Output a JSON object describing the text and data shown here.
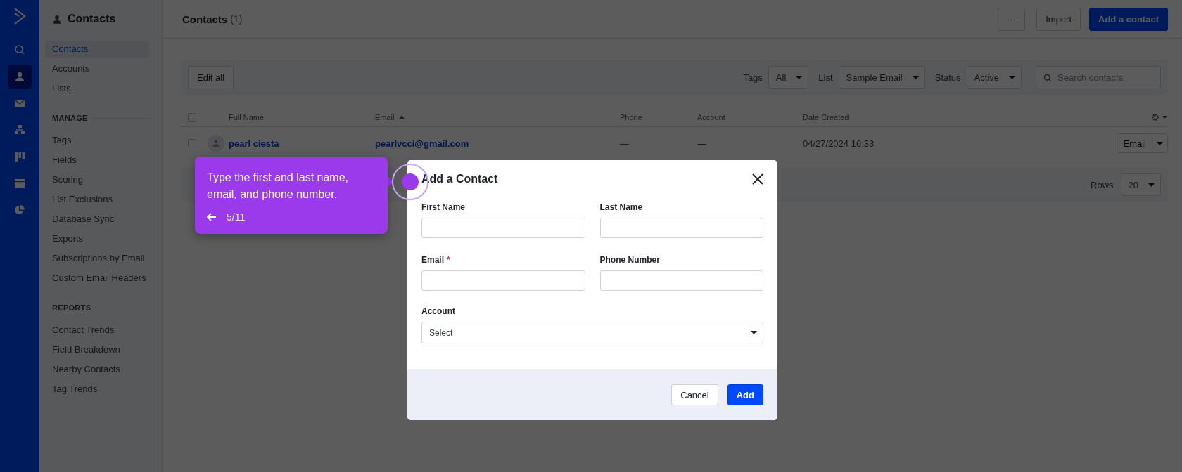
{
  "nav_rail": {
    "items": [
      {
        "kind": "search",
        "selected": false
      },
      {
        "kind": "contacts",
        "selected": true
      },
      {
        "kind": "email",
        "selected": false
      },
      {
        "kind": "automation",
        "selected": false
      },
      {
        "kind": "pipeline",
        "selected": false
      },
      {
        "kind": "website",
        "selected": false
      },
      {
        "kind": "reports",
        "selected": false
      }
    ]
  },
  "sidebar": {
    "title": "Contacts",
    "items": [
      {
        "label": "Contacts",
        "selected": true
      },
      {
        "label": "Accounts",
        "selected": false
      },
      {
        "label": "Lists",
        "selected": false
      }
    ],
    "sections": [
      {
        "heading": "MANAGE",
        "items": [
          {
            "label": "Tags",
            "selected": false
          },
          {
            "label": "Fields",
            "selected": false
          },
          {
            "label": "Scoring",
            "selected": false
          },
          {
            "label": "List Exclusions",
            "selected": false
          },
          {
            "label": "Database Sync",
            "selected": false
          },
          {
            "label": "Exports",
            "selected": false
          },
          {
            "label": "Subscriptions by Email",
            "selected": false
          },
          {
            "label": "Custom Email Headers",
            "selected": false
          }
        ]
      },
      {
        "heading": "REPORTS",
        "items": [
          {
            "label": "Contact Trends",
            "selected": false
          },
          {
            "label": "Field Breakdown",
            "selected": false
          },
          {
            "label": "Nearby Contacts",
            "selected": false
          },
          {
            "label": "Tag Trends",
            "selected": false
          }
        ]
      }
    ]
  },
  "header": {
    "title": "Contacts",
    "count": "(1)",
    "more_button": "···",
    "import_button": "Import",
    "add_button": "Add a contact"
  },
  "toolbar": {
    "edit_all": "Edit all",
    "filters": [
      {
        "label": "Tags",
        "value": "All"
      },
      {
        "label": "List",
        "value": "Sample Email"
      },
      {
        "label": "Status",
        "value": "Active"
      }
    ],
    "search": {
      "placeholder": "Search contacts"
    }
  },
  "table": {
    "select_all_checked": false,
    "columns": [
      {
        "label": "Full Name",
        "sorted": false
      },
      {
        "label": "Email",
        "sorted": true
      },
      {
        "label": "Phone",
        "sorted": false
      },
      {
        "label": "Account",
        "sorted": false
      },
      {
        "label": "Date Created",
        "sorted": false
      }
    ],
    "rows": [
      {
        "checked": false,
        "name": "pearl ciesta",
        "email": "pearlvcci@gmail.com",
        "phone": "—",
        "account": "—",
        "date_created": "04/27/2024 16:33",
        "action": "Email"
      }
    ]
  },
  "pagination": {
    "label": "Rows",
    "value": "20"
  },
  "modal": {
    "title": "Add a Contact",
    "fields": [
      {
        "label": "First Name"
      },
      {
        "label": "Last Name"
      },
      {
        "label": "Email",
        "required_mark": "*"
      },
      {
        "label": "Phone Number"
      }
    ],
    "account": {
      "label": "Account",
      "value": "Select"
    },
    "cancel_button": "Cancel",
    "add_button": "Add"
  },
  "tooltip": {
    "text": "Type the first and last name, email, and phone number.",
    "step": "5/11"
  }
}
